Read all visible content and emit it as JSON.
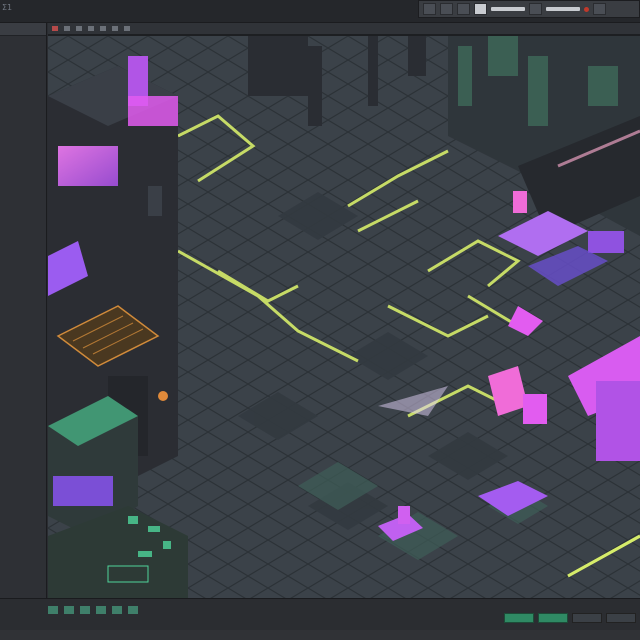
{
  "window": {
    "title": "Σ1"
  },
  "colors": {
    "floor": "#3b4249",
    "neon_pink": "#e25cf0",
    "neon_purple": "#9b5cf0",
    "neon_yellow": "#d6ec6a",
    "neon_green": "#4ed49a",
    "machine_dark": "#2b2d33"
  },
  "icons": {
    "topbar_tools": [
      "select-tool-icon",
      "line-tool-icon",
      "slider-icon",
      "record-icon"
    ],
    "viewport_tabs": [
      "close-icon",
      "tab-icon",
      "tab-icon",
      "tab-icon",
      "tab-icon",
      "tab-icon",
      "tab-icon"
    ]
  }
}
